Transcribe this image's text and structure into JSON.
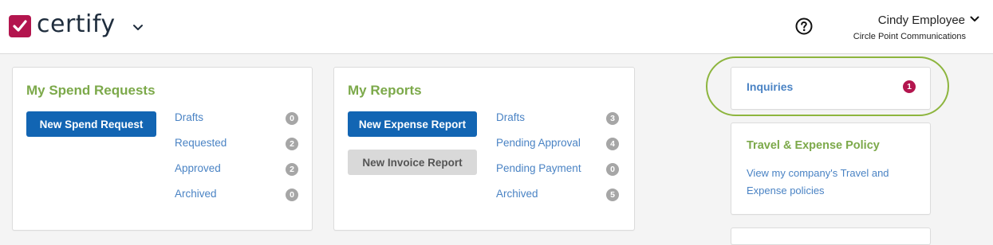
{
  "header": {
    "logo_text": "certify",
    "user_name": "Cindy Employee",
    "company": "Circle Point Communications"
  },
  "colors": {
    "brand": "#b3154e",
    "primary_button": "#1265b3",
    "title_green": "#7ca94a",
    "link_blue": "#4a83c4",
    "highlight_ring": "#8db53e"
  },
  "icons": [
    "certify-logo-icon",
    "chevron-down-icon",
    "help-icon"
  ],
  "spend_requests": {
    "title": "My Spend Requests",
    "new_button": "New Spend Request",
    "items": [
      {
        "label": "Drafts",
        "count": "0"
      },
      {
        "label": "Requested",
        "count": "2"
      },
      {
        "label": "Approved",
        "count": "2"
      },
      {
        "label": "Archived",
        "count": "0"
      }
    ]
  },
  "reports": {
    "title": "My Reports",
    "new_expense_button": "New Expense Report",
    "new_invoice_button": "New Invoice Report",
    "items": [
      {
        "label": "Drafts",
        "count": "3"
      },
      {
        "label": "Pending Approval",
        "count": "4"
      },
      {
        "label": "Pending Payment",
        "count": "0"
      },
      {
        "label": "Archived",
        "count": "5"
      }
    ]
  },
  "inquiries": {
    "title": "Inquiries",
    "count": "1"
  },
  "policy": {
    "title": "Travel & Expense Policy",
    "link": "View my company's Travel and Expense policies"
  }
}
